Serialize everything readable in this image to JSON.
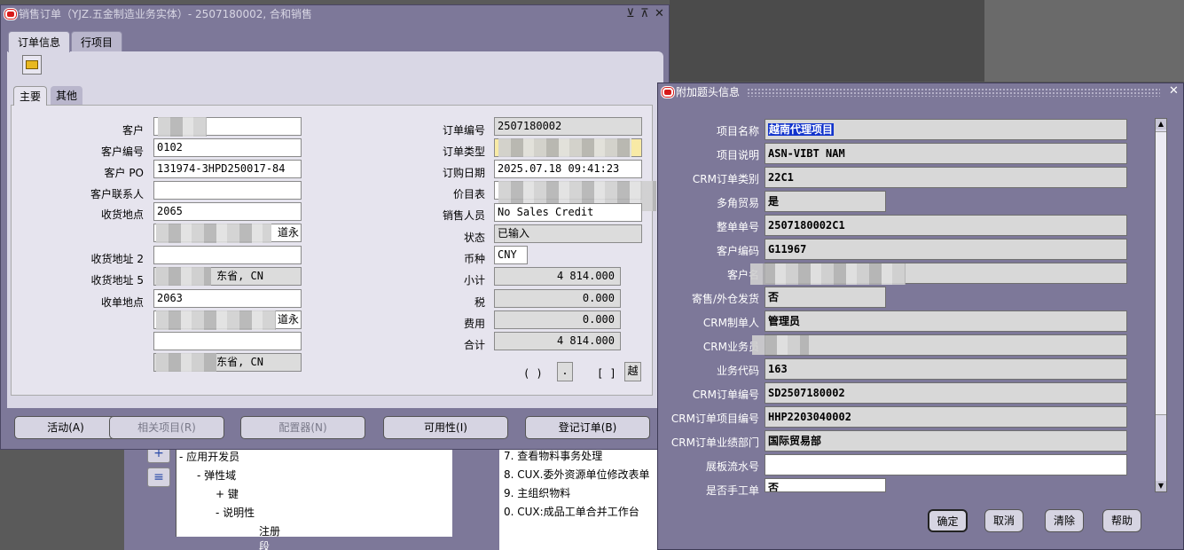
{
  "main_window": {
    "title": "销售订单（YJZ.五金制造业务实体）- 2507180002, 合和销售",
    "controls": {
      "minimize": "⊻",
      "maximize": "⊼",
      "close": "✕"
    },
    "tabs": [
      "订单信息",
      "行项目"
    ],
    "subtabs": [
      "主要",
      "其他"
    ],
    "left_labels": {
      "customer": "客户",
      "customer_no": "客户编号",
      "customer_po": "客户 PO",
      "contact": "客户联系人",
      "ship_to": "收货地点",
      "ship_addr2": "收货地址 2",
      "ship_addr5": "收货地址 5",
      "bill_to": "收单地点"
    },
    "left_values": {
      "customer_no": "0102",
      "customer_po": "131974-3HPD250017-84",
      "ship_to": "2065",
      "ship_addr_line": "道永",
      "ship_addr5": "东省, CN",
      "bill_to": "2063",
      "bill_addr_line": "道永",
      "bill_addr_prov": "东省, CN"
    },
    "right_labels": {
      "order_no": "订单编号",
      "order_type": "订单类型",
      "order_date": "订购日期",
      "price_list": "价目表",
      "salesperson": "销售人员",
      "status": "状态",
      "currency": "币种",
      "subtotal": "小计",
      "tax": "税",
      "charges": "费用",
      "total": "合计"
    },
    "right_values": {
      "order_no": "2507180002",
      "order_date": "2025.07.18 09:41:23",
      "salesperson": "No Sales Credit",
      "status": "已输入",
      "currency": "CNY",
      "subtotal": "4 814.000",
      "tax": "0.000",
      "charges": "0.000",
      "total": "4 814.000"
    },
    "small_controls": {
      "paren": "( )",
      "dot": ".",
      "bracket": "[ ]",
      "yue": "越"
    },
    "buttons": [
      "活动(A)",
      "相关项目(R)",
      "配置器(N)",
      "可用性(I)",
      "登记订单(B)"
    ]
  },
  "navigator": {
    "tree": [
      "-  应用开发员",
      "-  弹性域",
      "+  键",
      "-  说明性",
      "注册",
      "段"
    ],
    "list": [
      "7. 查看物料事务处理",
      "8. CUX.委外资源单位修改表单",
      "9. 主组织物料",
      "0. CUX:成品工单合并工作台"
    ],
    "buttons": {
      "expand": "+",
      "collapse": "≡"
    }
  },
  "dialog": {
    "title": "附加题头信息",
    "close": "✕",
    "labels": [
      "项目名称",
      "项目说明",
      "CRM订单类别",
      "多角贸易",
      "整单单号",
      "客户编码",
      "客户名",
      "寄售/外仓发货",
      "CRM制单人",
      "CRM业务员",
      "业务代码",
      "CRM订单编号",
      "CRM订单项目编号",
      "CRM订单业绩部门",
      "展板流水号",
      "是否手工单"
    ],
    "values": [
      "越南代理项目",
      "ASN-VIBT NAM",
      "22C1",
      "是",
      "2507180002C1",
      "G11967",
      "",
      "否",
      "管理员",
      "",
      "163",
      "SD2507180002",
      "HHP2203040002",
      "国际贸易部",
      "",
      "否"
    ],
    "buttons": [
      "确定",
      "取消",
      "清除",
      "帮助"
    ]
  }
}
